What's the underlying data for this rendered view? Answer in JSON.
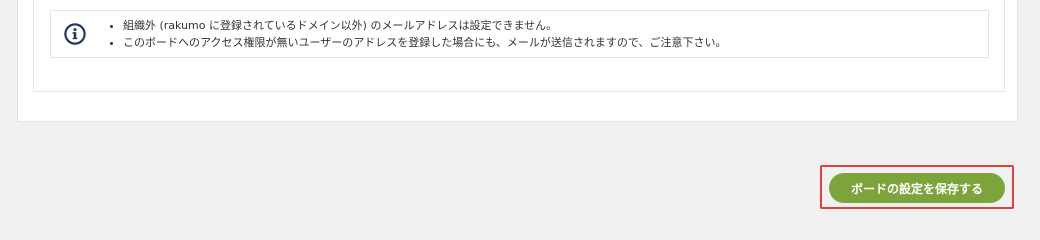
{
  "notice": {
    "icon": "info-circle-icon",
    "items": [
      "組織外 (rakumo に登録されているドメイン以外) のメールアドレスは設定できません。",
      "このボードへのアクセス権限が無いユーザーのアドレスを登録した場合にも、メールが送信されますので、ご注意下さい。"
    ]
  },
  "actions": {
    "save_label": "ボードの設定を保存する"
  },
  "colors": {
    "page_background": "#f0f0f0",
    "button_green": "#7da43a",
    "highlight_red": "#e0403c",
    "icon_navy": "#1f3a5f"
  }
}
